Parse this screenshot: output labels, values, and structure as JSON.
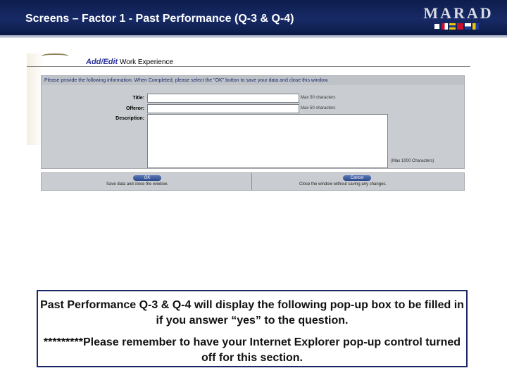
{
  "slide": {
    "title": "Screens – Factor 1 - Past Performance (Q-3 & Q-4)",
    "logo_text": "MARAD",
    "header_color": "#13245c"
  },
  "popup": {
    "heading_prefix": "Add/Edit",
    "heading": "Work Experience",
    "instructions": "Please provide the following information. When Completed, please select the \"OK\" button to save your data and close this window.",
    "fields": [
      {
        "label": "Title:",
        "hint": "Max 50 characters"
      },
      {
        "label": "Offeror:",
        "hint": "Max 50 characters"
      },
      {
        "label": "Description:",
        "hint": "(Max 1000 Characters)"
      }
    ],
    "ok_button": "OK",
    "ok_caption": "Save data and close the window.",
    "cancel_button": "Cancel",
    "cancel_caption": "Close the window without saving any changes."
  },
  "caption": {
    "line1": "Past Performance Q-3 & Q-4 will display the following pop-up box to be filled in if you answer “yes” to the question.",
    "line2": "*********Please remember to have your Internet Explorer pop-up control turned off for this section."
  }
}
